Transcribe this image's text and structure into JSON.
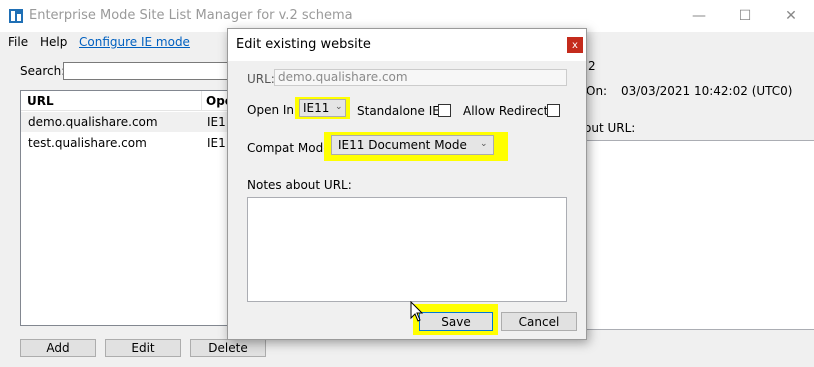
{
  "app": {
    "title": "Enterprise Mode Site List Manager for v.2 schema",
    "window_controls": {
      "minimize": "—",
      "maximize": "☐",
      "close": "✕"
    }
  },
  "menu": {
    "file": "File",
    "help": "Help",
    "configure": "Configure IE mode"
  },
  "search": {
    "label": "Search:",
    "value": ""
  },
  "list": {
    "headers": [
      "URL",
      "Ope"
    ],
    "rows": [
      {
        "url": "demo.qualishare.com",
        "open": "IE1"
      },
      {
        "url": "test.qualishare.com",
        "open": "IE1"
      }
    ]
  },
  "right_panel": {
    "version_suffix": "2",
    "modified_label": "On:",
    "modified_value": "03/03/2021 10:42:02 (UTC0)",
    "notes_label": "out URL:"
  },
  "main_buttons": {
    "add": "Add",
    "edit": "Edit",
    "delete": "Delete"
  },
  "dialog": {
    "title": "Edit existing website",
    "close": "x",
    "url_label": "URL:",
    "url_value": "demo.qualishare.com",
    "open_in_label": "Open In:",
    "open_in_value": "IE11",
    "standalone_label": "Standalone IE:",
    "standalone_checked": false,
    "allow_redirect_label": "Allow Redirect:",
    "allow_redirect_checked": false,
    "compat_label": "Compat Mode:",
    "compat_value": "IE11 Document Mode",
    "notes_label": "Notes about URL:",
    "notes_value": "",
    "save": "Save",
    "cancel": "Cancel"
  },
  "colors": {
    "highlight": "#ffff00",
    "link": "#0060c0",
    "close_red": "#c42b1c",
    "focus_blue": "#0078d7"
  }
}
